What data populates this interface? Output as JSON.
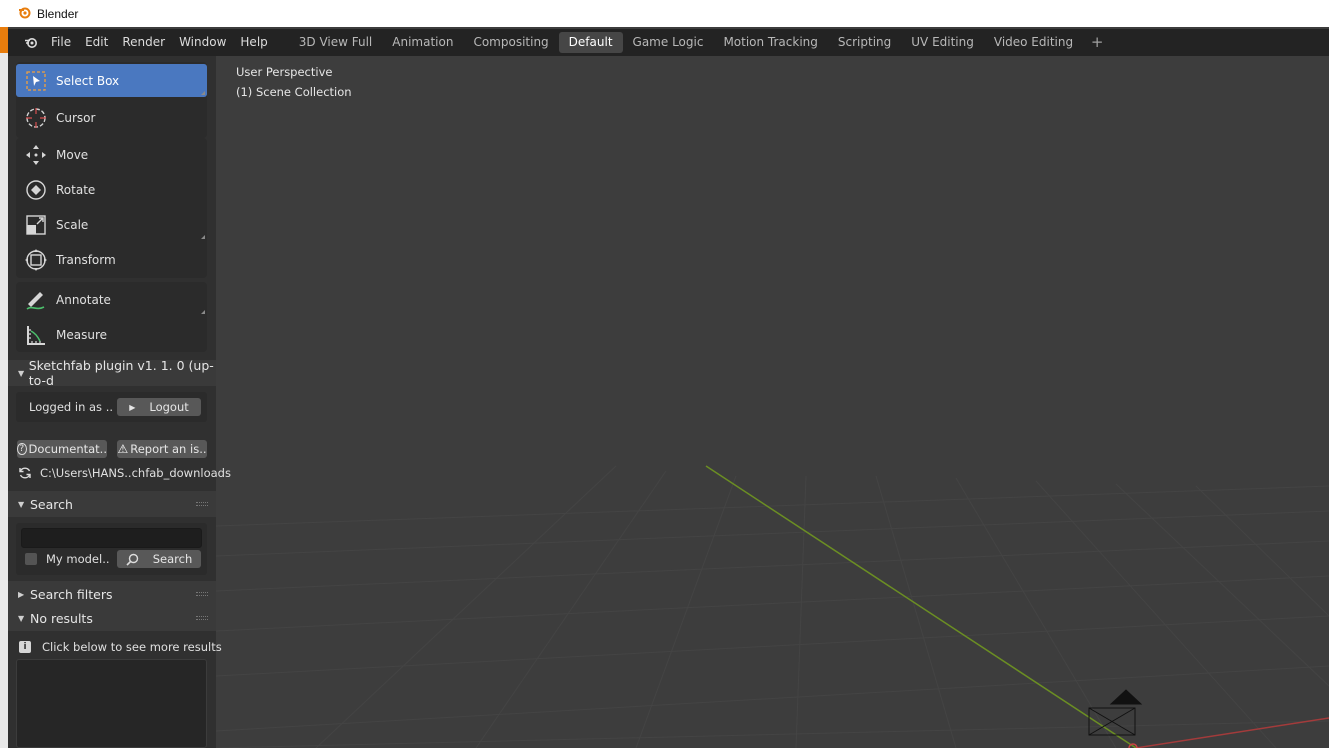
{
  "window": {
    "title": "Blender"
  },
  "menubar": {
    "items": [
      "File",
      "Edit",
      "Render",
      "Window",
      "Help"
    ]
  },
  "workspaces": {
    "tabs": [
      "3D View Full",
      "Animation",
      "Compositing",
      "Default",
      "Game Logic",
      "Motion Tracking",
      "Scripting",
      "UV Editing",
      "Video Editing"
    ],
    "active": "Default",
    "add_label": "+"
  },
  "tools": {
    "select_box": "Select Box",
    "cursor": "Cursor",
    "move": "Move",
    "rotate": "Rotate",
    "scale": "Scale",
    "transform": "Transform",
    "annotate": "Annotate",
    "measure": "Measure"
  },
  "sketchfab": {
    "header": "Sketchfab plugin v1. 1. 0 (up-to-d",
    "logged_in": "Logged in as ..",
    "logout": "Logout",
    "documentation": "Documentat..",
    "report": "Report an is..",
    "path": "C:\\Users\\HANS..chfab_downloads"
  },
  "search": {
    "header": "Search",
    "input_value": "",
    "my_models": "My model..",
    "button": "Search"
  },
  "search_filters": {
    "header": "Search filters"
  },
  "results": {
    "header": "No results",
    "hint": "Click below to see more results"
  },
  "viewport": {
    "perspective": "User Perspective",
    "collection": "(1) Scene Collection"
  },
  "colors": {
    "accent": "#4a78c0",
    "brand_orange": "#e87d0d",
    "y_axis": "#6b8e23",
    "x_axis": "#a33b3b"
  }
}
